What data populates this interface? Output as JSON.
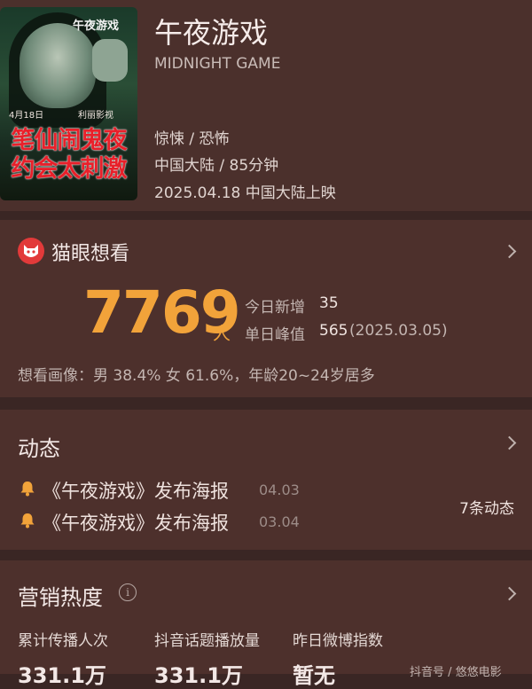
{
  "movie": {
    "title": "午夜游戏",
    "english_title": "MIDNIGHT GAME",
    "genre": "惊悚 / 恐怖",
    "region_duration": "中国大陆 / 85分钟",
    "release": "2025.04.18 中国大陆上映",
    "poster": {
      "brand": "午夜游戏",
      "date": "4月18日",
      "distributor": "利丽影视",
      "line1": "笔仙闹鬼夜",
      "line2": "约会太刺激"
    }
  },
  "maoyan": {
    "title": "猫眼想看",
    "count": "7769",
    "unit": "人",
    "today_label": "今日新增",
    "today_value": "35",
    "peak_label": "单日峰值",
    "peak_value": "565",
    "peak_date": "(2025.03.05)",
    "portrait": "想看画像：男 38.4%  女 61.6%，年龄20~24岁居多"
  },
  "dynamics": {
    "title": "动态",
    "items": [
      {
        "text": "《午夜游戏》发布海报",
        "date": "04.03"
      },
      {
        "text": "《午夜游戏》发布海报",
        "date": "03.04"
      }
    ],
    "count": "7条动态"
  },
  "marketing": {
    "title": "营销热度",
    "info_icon": "i",
    "columns": [
      {
        "label": "累计传播人次",
        "value": "331.1万"
      },
      {
        "label": "抖音话题播放量",
        "value": "331.1万"
      },
      {
        "label": "昨日微博指数",
        "value": "暂无"
      }
    ]
  },
  "watermark": "抖音号 / 悠悠电影",
  "colors": {
    "accent": "#f2a33a",
    "background": "#3a2624",
    "card": "#4d302c"
  }
}
